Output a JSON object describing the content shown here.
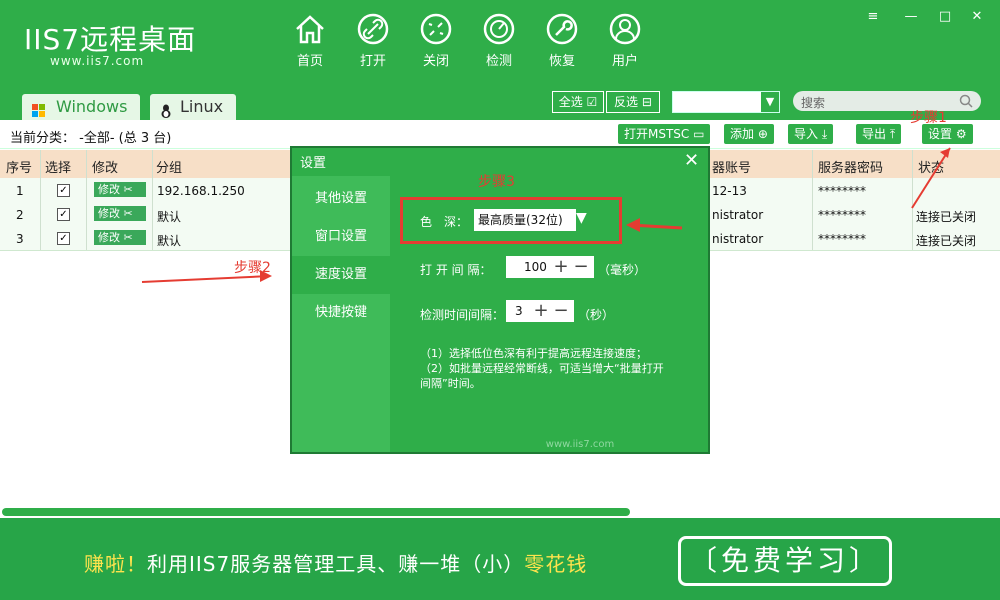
{
  "app": {
    "logo": "IIS7远程桌面",
    "url": "www.iis7.com"
  },
  "nav": [
    {
      "label": "首页",
      "icon": "home-icon"
    },
    {
      "label": "打开",
      "icon": "link-icon"
    },
    {
      "label": "关闭",
      "icon": "unlink-icon"
    },
    {
      "label": "检测",
      "icon": "gauge-icon"
    },
    {
      "label": "恢复",
      "icon": "wrench-icon"
    },
    {
      "label": "用户",
      "icon": "user-icon"
    }
  ],
  "window_controls": {
    "menu": "≡",
    "minimize": "—",
    "maximize": "□",
    "close": "✕"
  },
  "tabs": [
    {
      "label": "Windows",
      "icon": "windows-icon"
    },
    {
      "label": "Linux",
      "icon": "linux-icon"
    }
  ],
  "select_all": "全选",
  "invert_select": "反选",
  "search": {
    "placeholder": "搜索"
  },
  "category": {
    "label": "当前分类：",
    "value": "-全部- (总 3 台)"
  },
  "toolbar": {
    "open_mstsc": "打开MSTSC",
    "add": "添加",
    "import": "导入",
    "export": "导出",
    "settings": "设置"
  },
  "table": {
    "headers": [
      "序号",
      "选择",
      "修改",
      "分组",
      "器账号",
      "服务器密码",
      "状态"
    ],
    "rows": [
      {
        "num": "1",
        "edit": "修改",
        "group": "192.168.1.250",
        "account": "12-13",
        "password": "********",
        "status": ""
      },
      {
        "num": "2",
        "edit": "修改",
        "group": "默认",
        "account": "nistrator",
        "password": "********",
        "status": "连接已关闭"
      },
      {
        "num": "3",
        "edit": "修改",
        "group": "默认",
        "account": "nistrator",
        "password": "********",
        "status": "连接已关闭"
      }
    ]
  },
  "dialog": {
    "title": "设置",
    "sidebar": [
      "其他设置",
      "窗口设置",
      "速度设置",
      "快捷按键"
    ],
    "color_depth_label": "色　深：",
    "color_depth_value": "最高质量(32位)",
    "open_interval_label": "打 开 间 隔：",
    "open_interval_value": "100",
    "open_interval_unit": "（毫秒）",
    "check_interval_label": "检测时间间隔：",
    "check_interval_value": "3",
    "check_interval_unit": "（秒）",
    "note1": "（1）选择低位色深有利于提高远程连接速度；",
    "note2": "（2）如批量远程经常断线，可适当增大“批量打开间隔”时间。",
    "footer": "www.iis7.com"
  },
  "annotations": {
    "step1": "步骤1",
    "step2": "步骤2",
    "step3": "步骤3"
  },
  "banner": {
    "text_a": "赚啦！",
    "text_b": "利用IIS7服务器管理工具、赚一堆（小）",
    "text_c": "零花钱",
    "button": "〔免费学习〕"
  },
  "colors": {
    "brand": "#2fae49",
    "accent_red": "#e53c32",
    "banner_yellow": "#ffe34d"
  }
}
